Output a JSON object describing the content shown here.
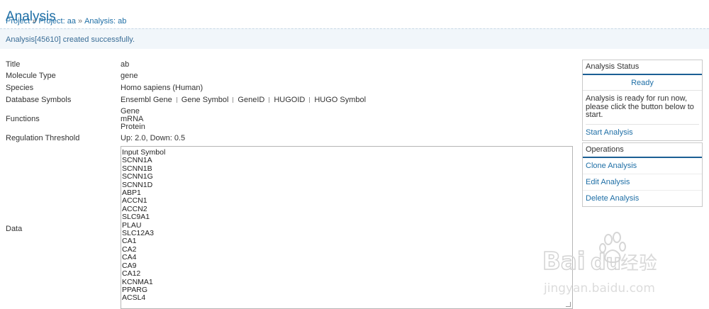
{
  "header": {
    "title": "Analysis",
    "breadcrumb": [
      "Project",
      "Project: aa",
      "Analysis: ab"
    ],
    "breadcrumb_separator": "»"
  },
  "notice": {
    "message": "Analysis[45610] created successfully."
  },
  "fields": {
    "title": {
      "label": "Title",
      "value": "ab"
    },
    "molecule_type": {
      "label": "Molecule Type",
      "value": "gene"
    },
    "species": {
      "label": "Species",
      "value": "Homo sapiens (Human)"
    },
    "database_symbols": {
      "label": "Database Symbols",
      "values": [
        "Ensembl Gene",
        "Gene Symbol",
        "GeneID",
        "HUGOID",
        "HUGO Symbol"
      ]
    },
    "functions": {
      "label": "Functions",
      "values": [
        "Gene",
        "mRNA",
        "Protein"
      ]
    },
    "regulation_threshold": {
      "label": "Regulation Threshold",
      "value": "Up: 2.0, Down: 0.5"
    },
    "data": {
      "label": "Data",
      "lines": [
        "Input Symbol",
        "SCNN1A",
        "SCNN1B",
        "SCNN1G",
        "SCNN1D",
        "ABP1",
        "ACCN1",
        "ACCN2",
        "SLC9A1",
        "PLAU",
        "SLC12A3",
        "CA1",
        "CA2",
        "CA4",
        "CA9",
        "CA12",
        "KCNMA1",
        "PPARG",
        "ACSL4"
      ]
    }
  },
  "status_panel": {
    "title": "Analysis Status",
    "state": "Ready",
    "description": "Analysis is ready for run now, please click the button below to start.",
    "action": "Start Analysis"
  },
  "operations_panel": {
    "title": "Operations",
    "links": [
      "Clone Analysis",
      "Edit Analysis",
      "Delete Analysis"
    ]
  },
  "watermark": {
    "text": "Bai du 经验",
    "subtext": "jingyan.baidu.com"
  },
  "colors": {
    "accent": "#1f6fa6",
    "panel_rule": "#1b5f94",
    "notice_bg": "#f1f6fa"
  }
}
